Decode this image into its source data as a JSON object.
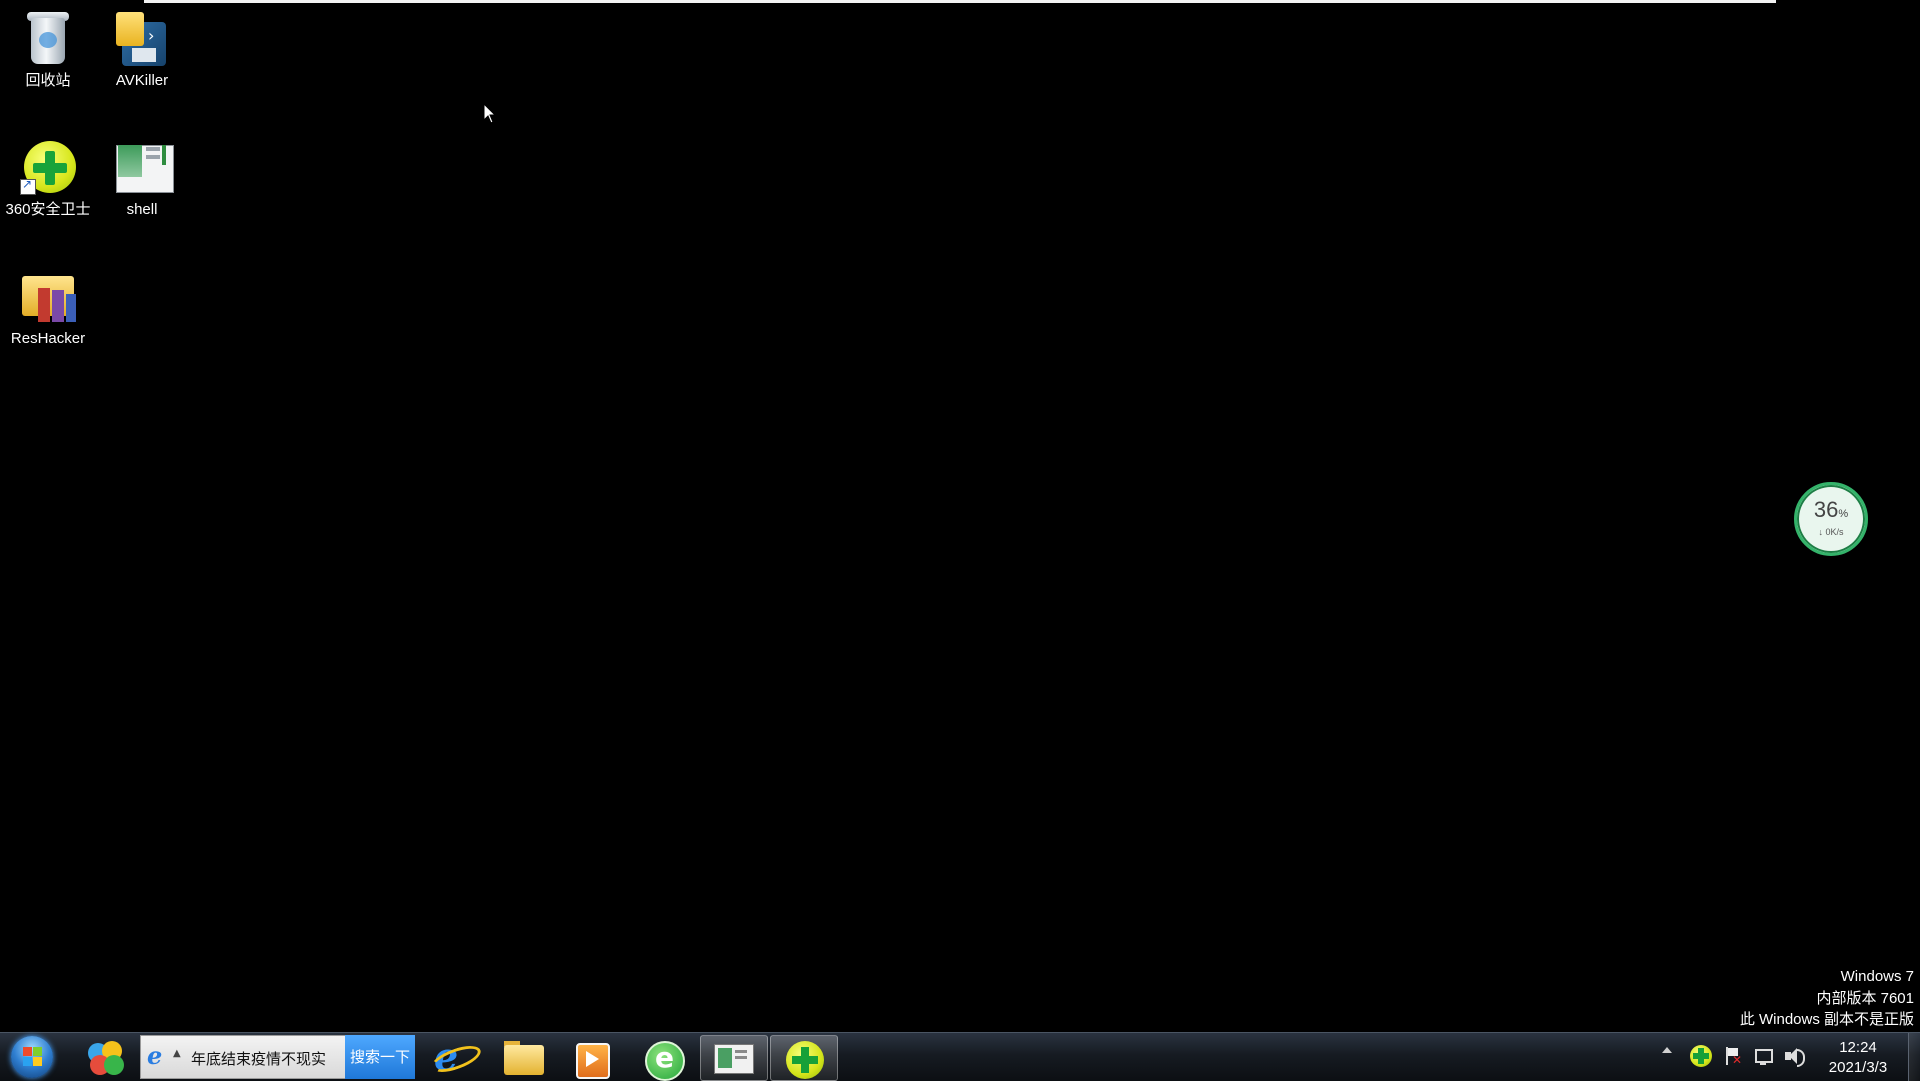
{
  "desktop": {
    "icons": [
      {
        "label": "回收站",
        "icon": "recycle-bin-icon"
      },
      {
        "label": "AVKiller",
        "icon": "avkiller-icon"
      },
      {
        "label": "360安全卫士",
        "icon": "360-security-icon"
      },
      {
        "label": "shell",
        "icon": "shell-app-icon"
      },
      {
        "label": "ResHacker",
        "icon": "reshacker-icon"
      }
    ],
    "speed_widget": {
      "percent": "36",
      "percent_sign": "%",
      "net": "↓ 0K/s",
      "accent": "#34b36a"
    },
    "watermark": {
      "line1": "Windows 7",
      "line2": "内部版本 7601",
      "line3": "此 Windows 副本不是正版"
    }
  },
  "taskbar": {
    "start_icon": "windows-start-orb-icon",
    "search": {
      "text": "年底结束疫情不现实",
      "button_label": "搜索一下",
      "button_color": "#1f78d8"
    },
    "pinned": [
      {
        "name": "360-software-manager",
        "icon": "360-colorful-balls-icon"
      },
      {
        "name": "internet-explorer",
        "icon": "internet-explorer-icon"
      },
      {
        "name": "windows-explorer",
        "icon": "folder-icon"
      },
      {
        "name": "media-player",
        "icon": "media-player-icon"
      },
      {
        "name": "360-browser",
        "icon": "360-browser-icon"
      },
      {
        "name": "shell",
        "icon": "shell-window-icon"
      },
      {
        "name": "360-security",
        "icon": "360-security-icon",
        "active": true
      }
    ],
    "tray": {
      "icons": [
        "show-hidden-icons-arrow-icon",
        "360-tray-icon",
        "action-center-flag-icon",
        "network-icon",
        "volume-icon"
      ],
      "time": "12:24",
      "date": "2021/3/3"
    }
  }
}
